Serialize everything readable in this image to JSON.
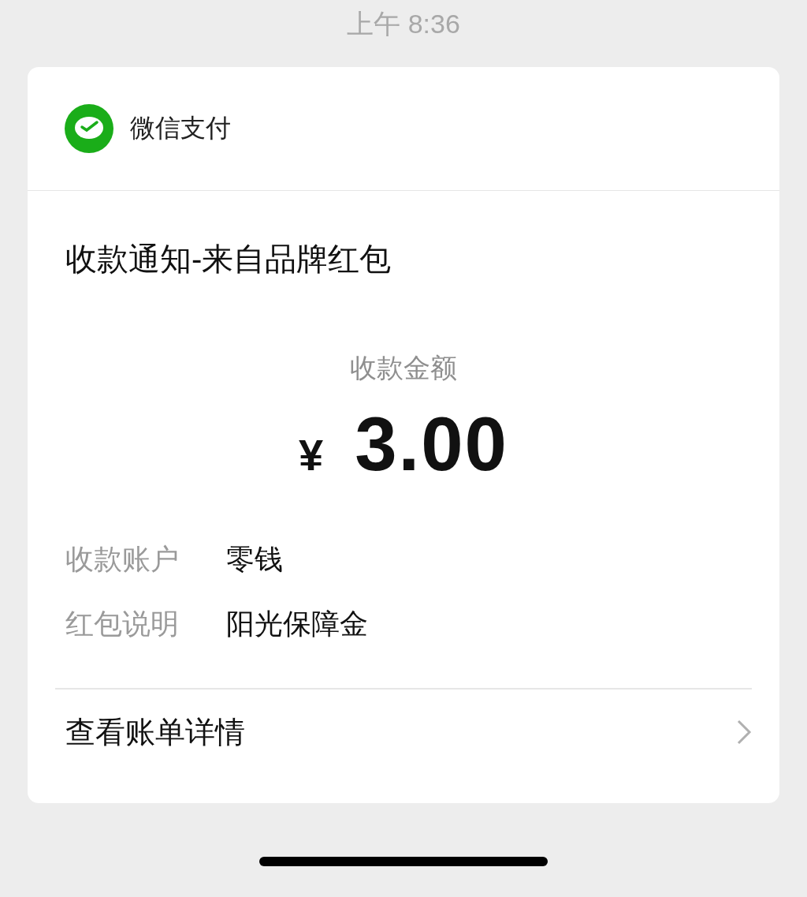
{
  "status_bar": {
    "time": "上午 8:36"
  },
  "card": {
    "app_name": "微信支付",
    "title": "收款通知-来自品牌红包",
    "amount_label": "收款金额",
    "currency": "¥",
    "amount": "3.00",
    "details": [
      {
        "label": "收款账户",
        "value": "零钱"
      },
      {
        "label": "红包说明",
        "value": "阳光保障金"
      }
    ],
    "link": "查看账单详情"
  }
}
